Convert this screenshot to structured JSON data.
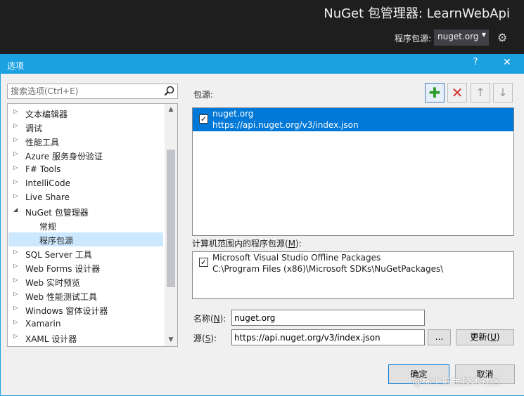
{
  "header": {
    "title": "NuGet 包管理器: LearnWebApi",
    "source_label": "程序包源:",
    "source_value": "nuget.org",
    "gear_icon": "settings-gear-icon"
  },
  "dialog": {
    "title": "选项",
    "help": "?",
    "close": "✕"
  },
  "search": {
    "placeholder": "搜索选项(Ctrl+E)"
  },
  "tree": {
    "items": [
      {
        "label": "文本编辑器",
        "expander": "▷"
      },
      {
        "label": "调试",
        "expander": "▷"
      },
      {
        "label": "性能工具",
        "expander": "▷"
      },
      {
        "label": "Azure 服务身份验证",
        "expander": "▷"
      },
      {
        "label": "F# Tools",
        "expander": "▷"
      },
      {
        "label": "IntelliCode",
        "expander": "▷"
      },
      {
        "label": "Live Share",
        "expander": "▷"
      },
      {
        "label": "NuGet 包管理器",
        "expander": "◢"
      },
      {
        "label": "常规",
        "expander": ""
      },
      {
        "label": "程序包源",
        "expander": ""
      },
      {
        "label": "SQL Server 工具",
        "expander": "▷"
      },
      {
        "label": "Web Forms 设计器",
        "expander": "▷"
      },
      {
        "label": "Web 实时预览",
        "expander": "▷"
      },
      {
        "label": "Web 性能测试工具",
        "expander": "▷"
      },
      {
        "label": "Windows 窗体设计器",
        "expander": "▷"
      },
      {
        "label": "Xamarin",
        "expander": "▷"
      },
      {
        "label": "XAML 设计器",
        "expander": "▷"
      }
    ],
    "scroll_up": "▲",
    "scroll_down": "▼"
  },
  "sources": {
    "label": "包源:",
    "add": "✚",
    "remove": "✕",
    "up": "↑",
    "down": "↓",
    "items": [
      {
        "checked": "✓",
        "name": "nuget.org",
        "url": "https://api.nuget.org/v3/index.json"
      }
    ]
  },
  "machine": {
    "label_pre": "计算机范围内的程序包源(",
    "label_key": "M",
    "label_post": "):",
    "items": [
      {
        "checked": "✓",
        "name": "Microsoft Visual Studio Offline Packages",
        "path": "C:\\Program Files (x86)\\Microsoft SDKs\\NuGetPackages\\"
      }
    ]
  },
  "form": {
    "name_pre": "名称(",
    "name_key": "N",
    "name_post": "):",
    "name_value": "nuget.org",
    "source_pre": "源(",
    "source_key": "S",
    "source_post": "):",
    "source_value": "https://api.nuget.org/v3/index.json",
    "browse": "...",
    "update_pre": "更新(",
    "update_key": "U",
    "update_post": ")"
  },
  "buttons": {
    "ok": "确定",
    "cancel": "取消"
  },
  "watermark": "@稀土掘金技术社区",
  "colors": {
    "accent": "#1ba1e2",
    "selection": "#0078d7",
    "tree_selected": "#cce8ff"
  }
}
